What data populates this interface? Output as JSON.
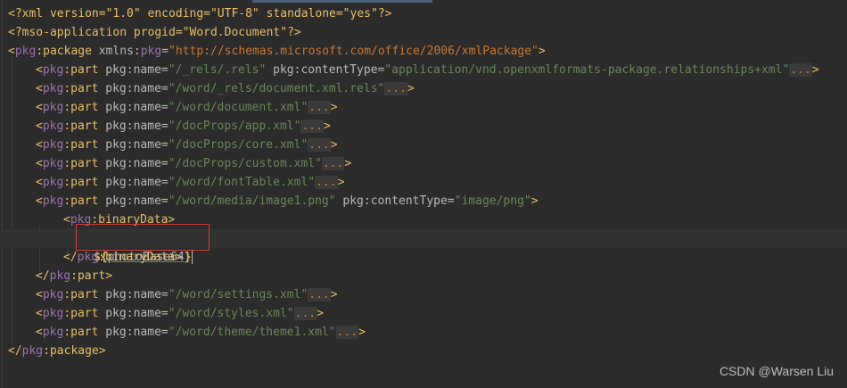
{
  "editor": {
    "lines": [
      {
        "text": "<?xml version=\"1.0\" encoding=\"UTF-8\" standalone=\"yes\"?>"
      },
      {
        "text": "<?mso-application progid=\"Word.Document\"?>"
      },
      {
        "open": "<",
        "ns": "pkg",
        "sep": ":",
        "tag": "package",
        "attr1": " xmlns:",
        "attr1ns": "pkg",
        "eq": "=",
        "val": "\"http://schemas.microsoft.com/office/2006/xmlPackage\"",
        "close": ">"
      },
      {
        "open": "<",
        "ns": "pkg",
        "tag": ":part",
        "attr": " pkg:name=",
        "val": "\"/_rels/.rels\"",
        "attr2": " pkg:contentType=",
        "val2": "\"application/vnd.openxmlformats-package.relationships+xml\"",
        "fold": "...",
        "close": ">"
      },
      {
        "open": "<",
        "ns": "pkg",
        "tag": ":part",
        "attr": " pkg:name=",
        "val": "\"/word/_rels/document.xml.rels\"",
        "fold": "...",
        "close": ">"
      },
      {
        "open": "<",
        "ns": "pkg",
        "tag": ":part",
        "attr": " pkg:name=",
        "val": "\"/word/document.xml\"",
        "fold": "...",
        "close": ">"
      },
      {
        "open": "<",
        "ns": "pkg",
        "tag": ":part",
        "attr": " pkg:name=",
        "val": "\"/docProps/app.xml\"",
        "fold": "...",
        "close": ">"
      },
      {
        "open": "<",
        "ns": "pkg",
        "tag": ":part",
        "attr": " pkg:name=",
        "val": "\"/docProps/core.xml\"",
        "fold": "...",
        "close": ">"
      },
      {
        "open": "<",
        "ns": "pkg",
        "tag": ":part",
        "attr": " pkg:name=",
        "val": "\"/docProps/custom.xml\"",
        "fold": "...",
        "close": ">"
      },
      {
        "open": "<",
        "ns": "pkg",
        "tag": ":part",
        "attr": " pkg:name=",
        "val": "\"/word/fontTable.xml\"",
        "fold": "...",
        "close": ">"
      },
      {
        "open": "<",
        "ns": "pkg",
        "tag": ":part",
        "attr": " pkg:name=",
        "val": "\"/word/media/image1.png\"",
        "attr2": " pkg:contentType=",
        "val2": "\"image/png\"",
        "close": ">"
      },
      {
        "open": "<",
        "ns": "pkg",
        "tag": ":binaryData",
        "close": ">"
      },
      {
        "tpl_open": "${",
        "var": "photoBase64",
        "tpl_close": "}"
      },
      {
        "open": "</",
        "ns": "pkg",
        "tag": ":binaryData",
        "close": ">"
      },
      {
        "open": "</",
        "ns": "pkg",
        "tag": ":part",
        "close": ">"
      },
      {
        "open": "<",
        "ns": "pkg",
        "tag": ":part",
        "attr": " pkg:name=",
        "val": "\"/word/settings.xml\"",
        "fold": "...",
        "close": ">"
      },
      {
        "open": "<",
        "ns": "pkg",
        "tag": ":part",
        "attr": " pkg:name=",
        "val": "\"/word/styles.xml\"",
        "fold": "...",
        "close": ">"
      },
      {
        "open": "<",
        "ns": "pkg",
        "tag": ":part",
        "attr": " pkg:name=",
        "val": "\"/word/theme/theme1.xml\"",
        "fold": "...",
        "close": ">"
      },
      {
        "open": "</",
        "ns": "pkg",
        "tag": ":package",
        "close": ">"
      }
    ]
  },
  "watermark": "CSDN @Warsen Liu"
}
